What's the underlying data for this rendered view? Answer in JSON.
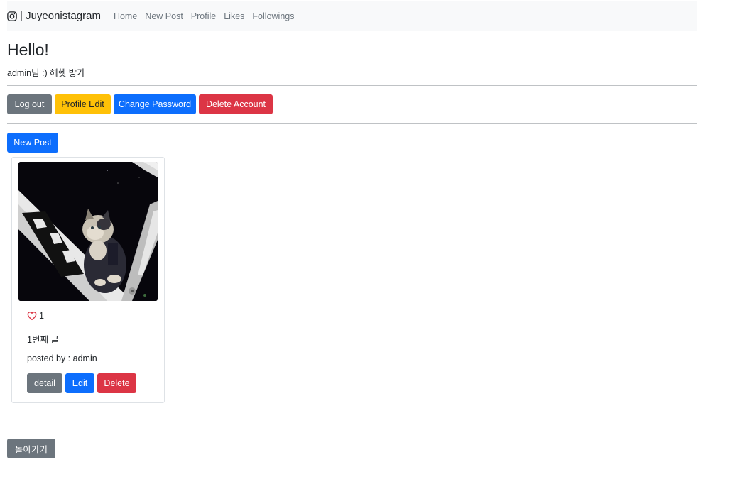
{
  "navbar": {
    "brand": "| Juyeonistagram",
    "links": [
      "Home",
      "New Post",
      "Profile",
      "Likes",
      "Followings"
    ]
  },
  "greeting": {
    "title": "Hello!",
    "subtitle": "admin님 :) 헤헷 방가"
  },
  "account_actions": {
    "logout": "Log out",
    "profile_edit": "Profile Edit",
    "change_password": "Change Password",
    "delete_account": "Delete Account"
  },
  "new_post_button": "New Post",
  "posts": [
    {
      "likes": "1",
      "title": "1번째 글",
      "posted_by_label": "posted by : ",
      "author": "admin",
      "detail_label": "detail",
      "edit_label": "Edit",
      "delete_label": "Delete"
    }
  ],
  "back_button": "돌아가기",
  "colors": {
    "secondary": "#6c757d",
    "warning": "#ffc107",
    "primary": "#0d6efd",
    "danger": "#dc3545",
    "heart": "#dc3545"
  }
}
